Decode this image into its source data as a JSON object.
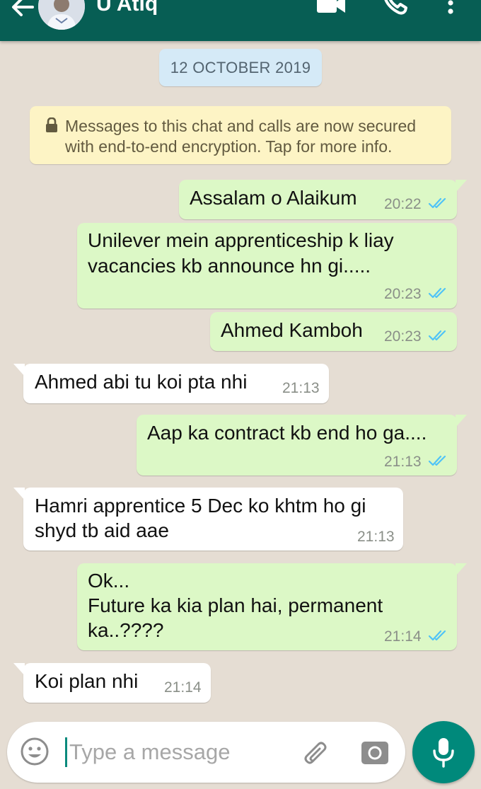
{
  "header": {
    "contact_name": "U Atiq"
  },
  "chat": {
    "date_label": "12 OCTOBER 2019",
    "encryption_notice_line1": "Messages to this chat and calls are now secured",
    "encryption_notice_line2": "with end-to-end encryption. Tap for more info.",
    "messages": [
      {
        "direction": "outgoing",
        "lines": [
          "Assalam o Alaikum"
        ],
        "time": "20:22",
        "status": "read"
      },
      {
        "direction": "outgoing",
        "lines": [
          "Unilever mein apprenticeship k liay",
          "vacancies kb announce hn gi....."
        ],
        "time": "20:23",
        "status": "read"
      },
      {
        "direction": "outgoing",
        "lines": [
          "Ahmed Kamboh"
        ],
        "time": "20:23",
        "status": "read"
      },
      {
        "direction": "incoming",
        "lines": [
          "Ahmed abi tu koi pta nhi"
        ],
        "time": "21:13"
      },
      {
        "direction": "outgoing",
        "lines": [
          "Aap ka contract kb end ho ga...."
        ],
        "time": "21:13",
        "status": "read"
      },
      {
        "direction": "incoming",
        "lines": [
          "Hamri apprentice 5 Dec ko khtm ho gi",
          "shyd tb aid aae"
        ],
        "time": "21:13"
      },
      {
        "direction": "outgoing",
        "lines": [
          "Ok...",
          "Future ka kia plan hai, permanent",
          "ka..????"
        ],
        "time": "21:14",
        "status": "read"
      },
      {
        "direction": "incoming",
        "lines": [
          "Koi plan nhi"
        ],
        "time": "21:14"
      }
    ]
  },
  "input": {
    "placeholder": "Type a message"
  },
  "colors": {
    "header": "#075e54",
    "wallpaper": "#e5ddd3",
    "outgoing_bubble": "#dcf8c6",
    "incoming_bubble": "#ffffff",
    "read_tick": "#4fc3f7",
    "mic_button": "#00897b"
  },
  "icons": [
    "back-arrow-icon",
    "video-call-icon",
    "phone-icon",
    "more-vert-icon",
    "lock-icon",
    "double-tick-icon",
    "emoji-icon",
    "attach-icon",
    "camera-icon",
    "mic-icon"
  ]
}
